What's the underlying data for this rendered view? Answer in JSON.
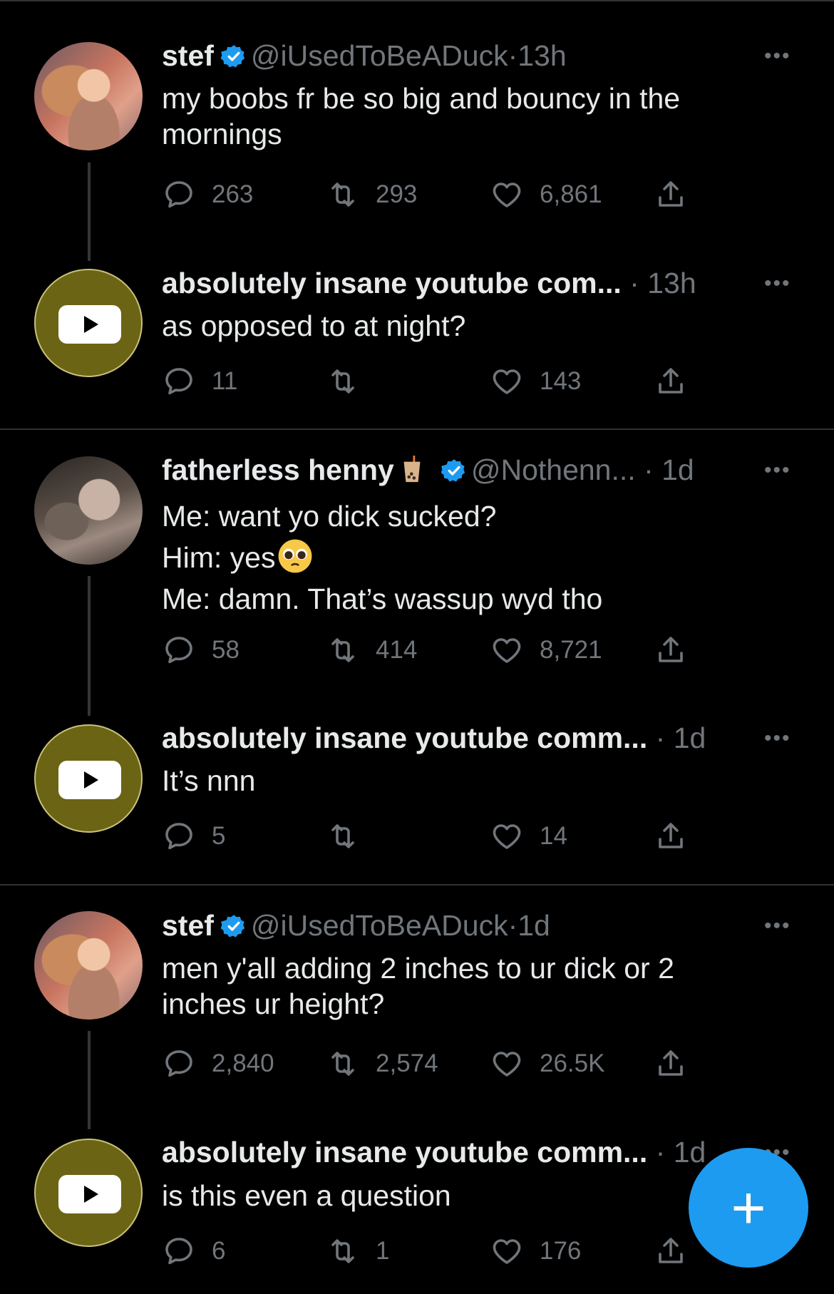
{
  "tweets": [
    {
      "name": "stef",
      "handle": "@iUsedToBeADuck",
      "time": "13h",
      "lines": [
        "my boobs fr be so big and bouncy in the",
        "mornings"
      ],
      "replies": "263",
      "retweets": "293",
      "likes": "6,861"
    },
    {
      "name": "absolutely insane youtube com...",
      "time": "13h",
      "lines": [
        "as opposed to at night?"
      ],
      "replies": "11",
      "retweets": "",
      "likes": "143"
    },
    {
      "name": "fatherless henny",
      "handle": "@Nothenn...",
      "time": "1d",
      "lines": [
        "Me: want yo dick sucked?",
        "Him: yes",
        "Me: damn. That’s wassup wyd tho"
      ],
      "replies": "58",
      "retweets": "414",
      "likes": "8,721"
    },
    {
      "name": "absolutely insane youtube comm...",
      "time": "1d",
      "lines": [
        "It’s nnn"
      ],
      "replies": "5",
      "retweets": "",
      "likes": "14"
    },
    {
      "name": "stef",
      "handle": "@iUsedToBeADuck",
      "time": "1d",
      "lines": [
        "men y'all adding 2 inches to ur dick or 2",
        "inches ur height?"
      ],
      "replies": "2,840",
      "retweets": "2,574",
      "likes": "26.5K"
    },
    {
      "name": "absolutely insane youtube comm...",
      "time": "1d",
      "lines": [
        "is this even a question"
      ],
      "replies": "6",
      "retweets": "1",
      "likes": "176"
    }
  ],
  "separator": "·",
  "more_glyph": "•••",
  "fab_label": "+",
  "colors": {
    "accent": "#1d9bf0",
    "verified": "#1d9bf0",
    "muted": "#71767b",
    "youtube_avatar": "#6b6414"
  },
  "icons": [
    "reply-icon",
    "retweet-icon",
    "like-icon",
    "share-icon",
    "verified-badge-icon",
    "more-icon",
    "compose-icon"
  ]
}
